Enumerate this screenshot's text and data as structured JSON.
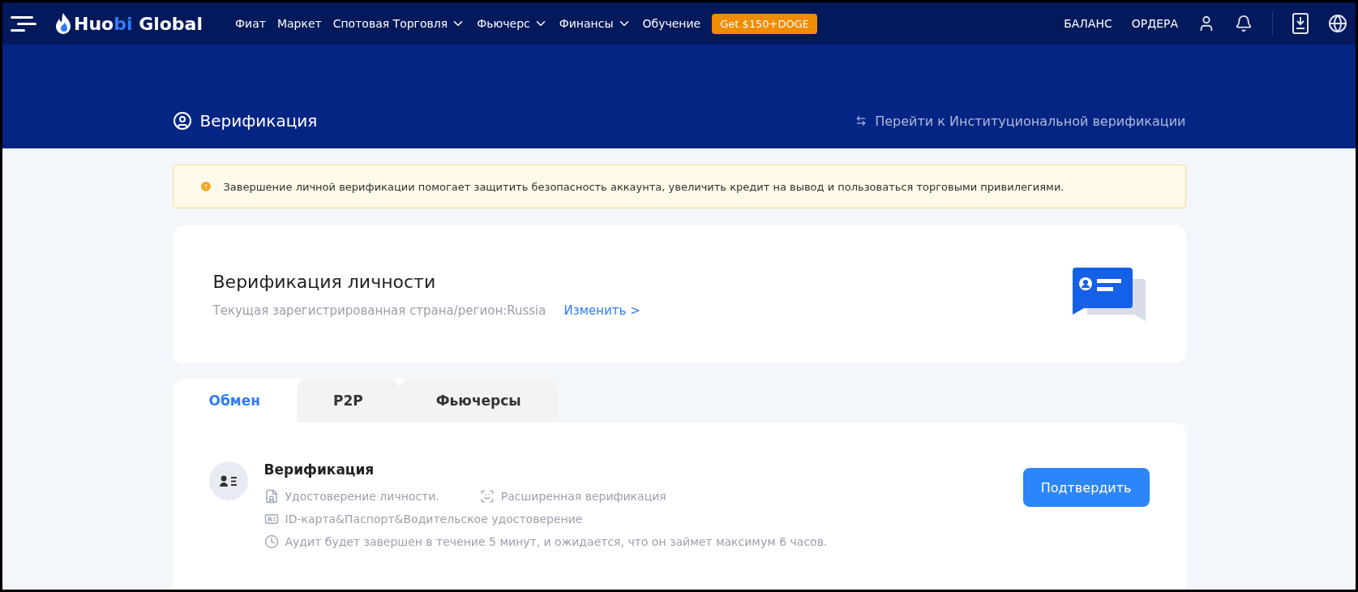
{
  "logo": {
    "segments": [
      {
        "text": "Huo",
        "accent": false
      },
      {
        "text": "bi",
        "accent": true
      },
      {
        "text": " Global",
        "accent": false
      }
    ]
  },
  "nav": [
    {
      "label": "Фиат",
      "has_menu": false
    },
    {
      "label": "Маркет",
      "has_menu": false
    },
    {
      "label": "Спотовая Торговля",
      "has_menu": true
    },
    {
      "label": "Фьючерс",
      "has_menu": true
    },
    {
      "label": "Финансы",
      "has_menu": true
    },
    {
      "label": "Обучение",
      "has_menu": false
    }
  ],
  "promo": "Get $150+DOGE",
  "account_links": [
    "БАЛАНС",
    "ОРДЕРА"
  ],
  "page_title": "Верификация",
  "institutional_link": "Перейти к Институциональной верификации",
  "notice": "Завершение личной верификации помогает защитить безопасность аккаунта, увеличить кредит на вывод и пользоваться торговыми привилегиями.",
  "identity": {
    "title": "Верификация личности",
    "country_label": "Текущая зарегистрированная страна/регион:Russia",
    "change_link": "Изменить >"
  },
  "tabs": [
    {
      "label": "Обмен",
      "selected": true
    },
    {
      "label": "P2P",
      "selected": false
    },
    {
      "label": "Фьючерсы",
      "selected": false
    }
  ],
  "level": {
    "title": "Верификация",
    "button": "Подтвердить",
    "requirements": [
      {
        "kind": "document",
        "text": "Удостоверение личности."
      },
      {
        "kind": "face",
        "text": "Расширенная верификация"
      }
    ],
    "details": [
      {
        "kind": "card",
        "text": "ID-карта&Паспорт&Водительское удостоверение"
      },
      {
        "kind": "clock",
        "text": "Аудит будет завершен в течение 5 минут, и ожидается, что он займет максимум 6 часов."
      }
    ]
  }
}
